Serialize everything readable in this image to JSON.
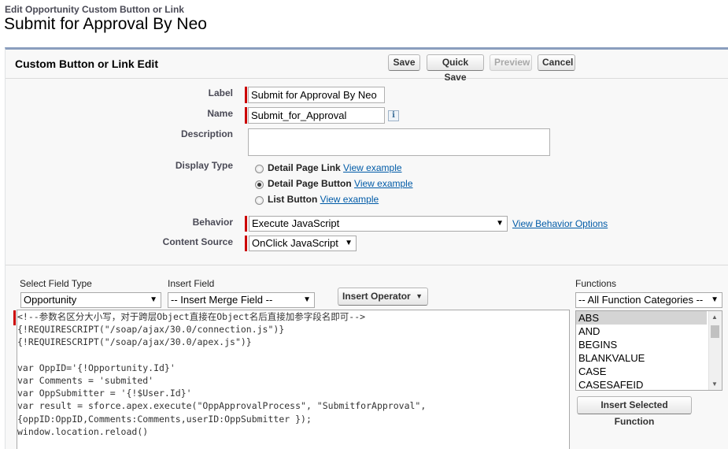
{
  "page": {
    "breadcrumb": "Edit Opportunity Custom Button or Link",
    "title": "Submit for Approval By Neo"
  },
  "panel": {
    "title": "Custom Button or Link Edit",
    "buttons": {
      "save": "Save",
      "quick_save": "Quick Save",
      "preview": "Preview",
      "cancel": "Cancel"
    }
  },
  "form": {
    "label_label": "Label",
    "label_value": "Submit for Approval By Neo",
    "name_label": "Name",
    "name_value": "Submit_for_Approval",
    "info_icon": "i",
    "description_label": "Description",
    "description_value": "",
    "display_type_label": "Display Type",
    "display_types": [
      {
        "label": "Detail Page Link",
        "link": "View example",
        "selected": false
      },
      {
        "label": "Detail Page Button",
        "link": "View example",
        "selected": true
      },
      {
        "label": "List Button",
        "link": "View example",
        "selected": false
      }
    ],
    "behavior_label": "Behavior",
    "behavior_value": "Execute JavaScript",
    "behavior_link": "View Behavior Options",
    "content_source_label": "Content Source",
    "content_source_value": "OnClick JavaScript"
  },
  "editor": {
    "select_field_type_label": "Select Field Type",
    "select_field_type_value": "Opportunity",
    "insert_field_label": "Insert Field",
    "insert_field_value": "-- Insert Merge Field --",
    "insert_operator_label": "Insert Operator",
    "functions_label": "Functions",
    "function_category_value": "-- All Function Categories --",
    "functions": [
      "ABS",
      "AND",
      "BEGINS",
      "BLANKVALUE",
      "CASE",
      "CASESAFEID"
    ],
    "selected_function": "ABS",
    "insert_function_button": "Insert Selected Function",
    "code_lines": [
      "<!--参数名区分大小写，对于跨层Object直接在Object名后直接加参字段名即可-->",
      "{!REQUIRESCRIPT(\"/soap/ajax/30.0/connection.js\")}",
      "{!REQUIRESCRIPT(\"/soap/ajax/30.0/apex.js\")}",
      "",
      "var OppID='{!Opportunity.Id}'",
      "var Comments = 'submited'",
      "var OppSubmitter = '{!$User.Id}'",
      "var result = sforce.apex.execute(\"OppApprovalProcess\", \"SubmitforApproval\",",
      "{oppID:OppID,Comments:Comments,userID:OppSubmitter });",
      "window.location.reload()"
    ]
  },
  "icons": {
    "dropdown": "chevron-down-icon",
    "info": "info-icon",
    "scroll_up": "scroll-up-icon",
    "scroll_down": "scroll-down-icon"
  },
  "colors": {
    "required_bar": "#cc0000",
    "panel_border": "#8a9ebe",
    "link": "#015ba7"
  }
}
